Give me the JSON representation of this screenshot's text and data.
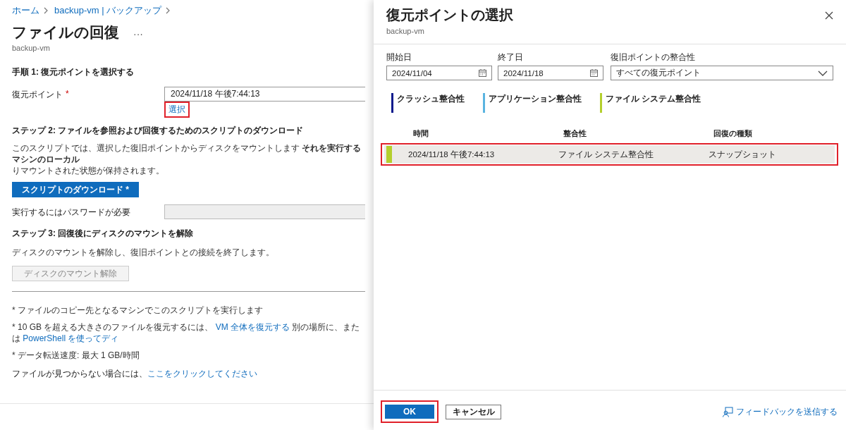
{
  "breadcrumb": [
    {
      "label": "ホーム"
    },
    {
      "label": "backup-vm | バックアップ"
    }
  ],
  "page": {
    "title": "ファイルの回復",
    "more": "···",
    "subtitle": "backup-vm"
  },
  "step1": {
    "heading": "手順 1: 復元ポイントを選択する",
    "label": "復元ポイント",
    "required_mark": "*",
    "value": "2024/11/18 午後7:44:13",
    "link": {
      "label": "選択",
      "annotated": true
    }
  },
  "step2": {
    "heading": "ステップ 2: ファイルを参照および回復するためのスクリプトのダウンロード",
    "text_lines": [
      "このスクリプトでは、選択した復旧ポイントからディスクをマウントします **それを実行するマシンのローカル**",
      "りマウントされた状態が保持されます。"
    ],
    "button": "スクリプトのダウンロード *",
    "password_label": "実行するにはパスワードが必要"
  },
  "step3": {
    "heading": "ステップ 3: 回復後にディスクのマウントを解除",
    "text": "ディスクのマウントを解除し、復旧ポイントとの接続を終了します。",
    "button": {
      "label": "ディスクのマウント解除",
      "disabled": true
    }
  },
  "notes": [
    {
      "parts": [
        {
          "kind": "text",
          "text": "* ファイルのコピー先となるマシンでこのスクリプトを実行します"
        }
      ]
    },
    {
      "parts": [
        {
          "kind": "text",
          "text": "* 10 GB を超える大きさのファイルを復元するには、"
        },
        {
          "kind": "link",
          "text": "VM 全体を復元する"
        },
        {
          "kind": "text",
          "text": "別の場所に、または"
        },
        {
          "kind": "link",
          "text": "PowerShell を使ってディ"
        }
      ]
    },
    {
      "parts": [
        {
          "kind": "text",
          "text": "* データ転送速度: 最大 1 GB/時間"
        }
      ]
    }
  ],
  "help": {
    "parts": [
      {
        "kind": "text",
        "text": "ファイルが見つからない場合には、"
      },
      {
        "kind": "link",
        "text": "ここをクリックしてください"
      }
    ]
  },
  "panel": {
    "title": "復元ポイントの選択",
    "subtitle": "backup-vm",
    "filters": [
      {
        "label": "開始日",
        "kind": "date",
        "value": "2024/11/04"
      },
      {
        "label": "終了日",
        "kind": "date",
        "value": "2024/11/18"
      },
      {
        "label": "復旧ポイントの整合性",
        "kind": "select",
        "value": "すべての復元ポイント"
      }
    ],
    "legend": [
      {
        "label": "クラッシュ整合性",
        "color": "#0b1a8c"
      },
      {
        "label": "アプリケーション整合性",
        "color": "#5ab4e0"
      },
      {
        "label": "ファイル システム整合性",
        "color": "#b4cf2d"
      }
    ],
    "table": {
      "columns": [
        "時間",
        "整合性",
        "回復の種類"
      ],
      "rows": [
        {
          "cells": [
            "2024/11/18 午後7:44:13",
            "ファイル システム整合性",
            "スナップショット"
          ],
          "color": "#b4cf2d",
          "selected": true,
          "annotated": true
        }
      ]
    },
    "buttons": [
      {
        "label": "OK",
        "kind": "primary",
        "annotated": true
      },
      {
        "label": "キャンセル",
        "kind": "secondary",
        "annotated": false
      }
    ],
    "feedback": "フィードバックを送信する"
  }
}
